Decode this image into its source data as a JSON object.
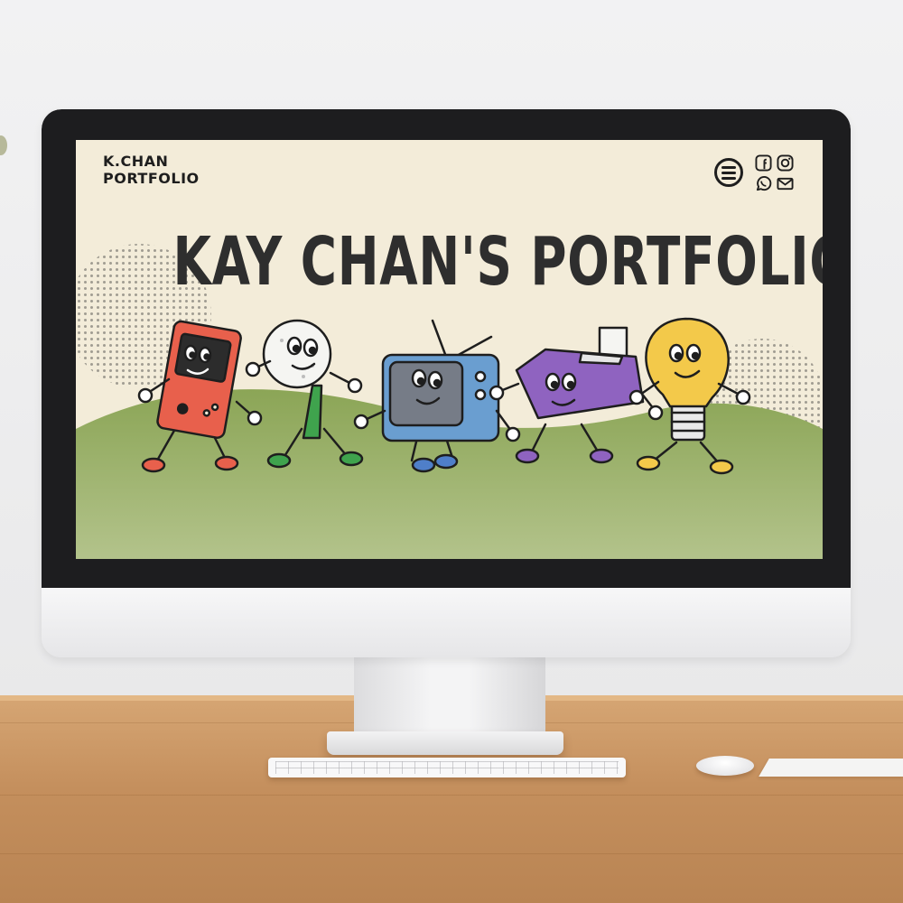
{
  "site": {
    "logo_line1": "K.CHAN",
    "logo_line2": "PORTFOLIO",
    "headline": "KAY CHAN'S PORTFOLIO"
  },
  "header_icons": [
    "menu-icon",
    "facebook-icon",
    "instagram-icon",
    "whatsapp-icon",
    "mail-icon"
  ],
  "mascots": [
    "handheld-game-console-mascot",
    "golf-ball-mascot",
    "television-mascot",
    "printer-mascot",
    "light-bulb-mascot"
  ],
  "colors": {
    "screen_bg": "#f3ecd9",
    "hill_green": "#8ba556",
    "ground_green": "#a6b878",
    "text_dark": "#2e2e2e",
    "console_red": "#e8604c",
    "tv_blue": "#6a9ed0",
    "printer_purple": "#8f63c0",
    "bulb_yellow": "#f3c94a",
    "desk_wood": "#c99561"
  }
}
